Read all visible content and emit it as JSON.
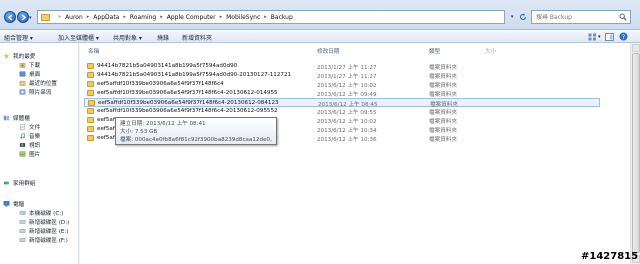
{
  "address_bar": {
    "breadcrumbs": [
      "Auron",
      "AppData",
      "Roaming",
      "Apple Computer",
      "MobileSync",
      "Backup"
    ],
    "search_placeholder": "搜尋 Backup"
  },
  "command_bar": {
    "items": [
      "組合管理 ▾",
      "加入至媒體櫃 ▾",
      "共用對象 ▾",
      "燒錄",
      "新增資料夾"
    ]
  },
  "nav_pane": {
    "favorites": {
      "label": "我的最愛",
      "items": [
        "下載",
        "桌面",
        "最近的位置",
        "照片串流"
      ]
    },
    "libraries": {
      "label": "媒體櫃",
      "items": [
        "文件",
        "音樂",
        "視訊",
        "圖片"
      ]
    },
    "homegroup": {
      "label": "家用群組"
    },
    "computer": {
      "label": "電腦",
      "items": [
        "本機磁碟 (C:)",
        "新增磁碟區 (D:)",
        "新增磁碟區 (E:)",
        "新增磁碟區 (F:)"
      ]
    }
  },
  "file_list": {
    "columns": {
      "name": "名稱",
      "date": "修改日期",
      "type": "類型",
      "size": "大小"
    },
    "rows": [
      {
        "name": "94414b7821b5a04903141a8b199a5f7594ad0d90",
        "date": "2013/1/27 上午 11:27",
        "type": "檔案資料夾"
      },
      {
        "name": "94414b7821b5a04903141a8b199a5f7594ad0d90-20130127-112721",
        "date": "2013/1/27 上午 11:27",
        "type": "檔案資料夾"
      },
      {
        "name": "eef5affdf10f339be03906a6e54f9f37f148f6c4",
        "date": "2013/6/12 上午 10:02",
        "type": "檔案資料夾"
      },
      {
        "name": "eef5affdf10f339be03906a6e54f9f37f148f6c4-20130612-014955",
        "date": "2013/6/12 上午 09:49",
        "type": "檔案資料夾"
      },
      {
        "name": "eef5affdf10f339be03906a6e54f9f37f148f6c4-20130612-084123",
        "date": "2013/6/12 上午 08:45",
        "type": "檔案資料夾"
      },
      {
        "name": "eef5affdf10f339be03906a6e54f9f37f148f6c4-20130612-095552",
        "date": "2013/6/12 上午 09:55",
        "type": "檔案資料夾"
      },
      {
        "name": "eef5affdf10f339be03906a6e54f9f37f148f6c4-20130612-100207",
        "date": "2013/6/12 上午 10:02",
        "type": "檔案資料夾"
      },
      {
        "name": "eef5affdf10f339be03906a6e54f9f37f148f6c4-20130612-103404",
        "date": "2013/6/12 上午 10:34",
        "type": "檔案資料夾"
      },
      {
        "name": "eef5affdf10f339be03906a6e54f9f37f148f6c4-20130612-103609",
        "date": "2013/6/12 上午 10:36",
        "type": "檔案資料夾"
      }
    ],
    "selected_index": 4
  },
  "tooltip": {
    "created": "建立日期: 2013/6/12 上午 08:41",
    "size": "大小: 7.53 GB",
    "files": "檔案: 000ac4e0fb8a6f81c92f3900ba8239d8caa12de0, ..."
  },
  "watermark": "#1427815",
  "colors": {
    "folder": "#f2c95f",
    "selection_bg": "#e9f2fc",
    "selection_border": "#9bc1ea",
    "chrome": "#dfe9f5"
  }
}
